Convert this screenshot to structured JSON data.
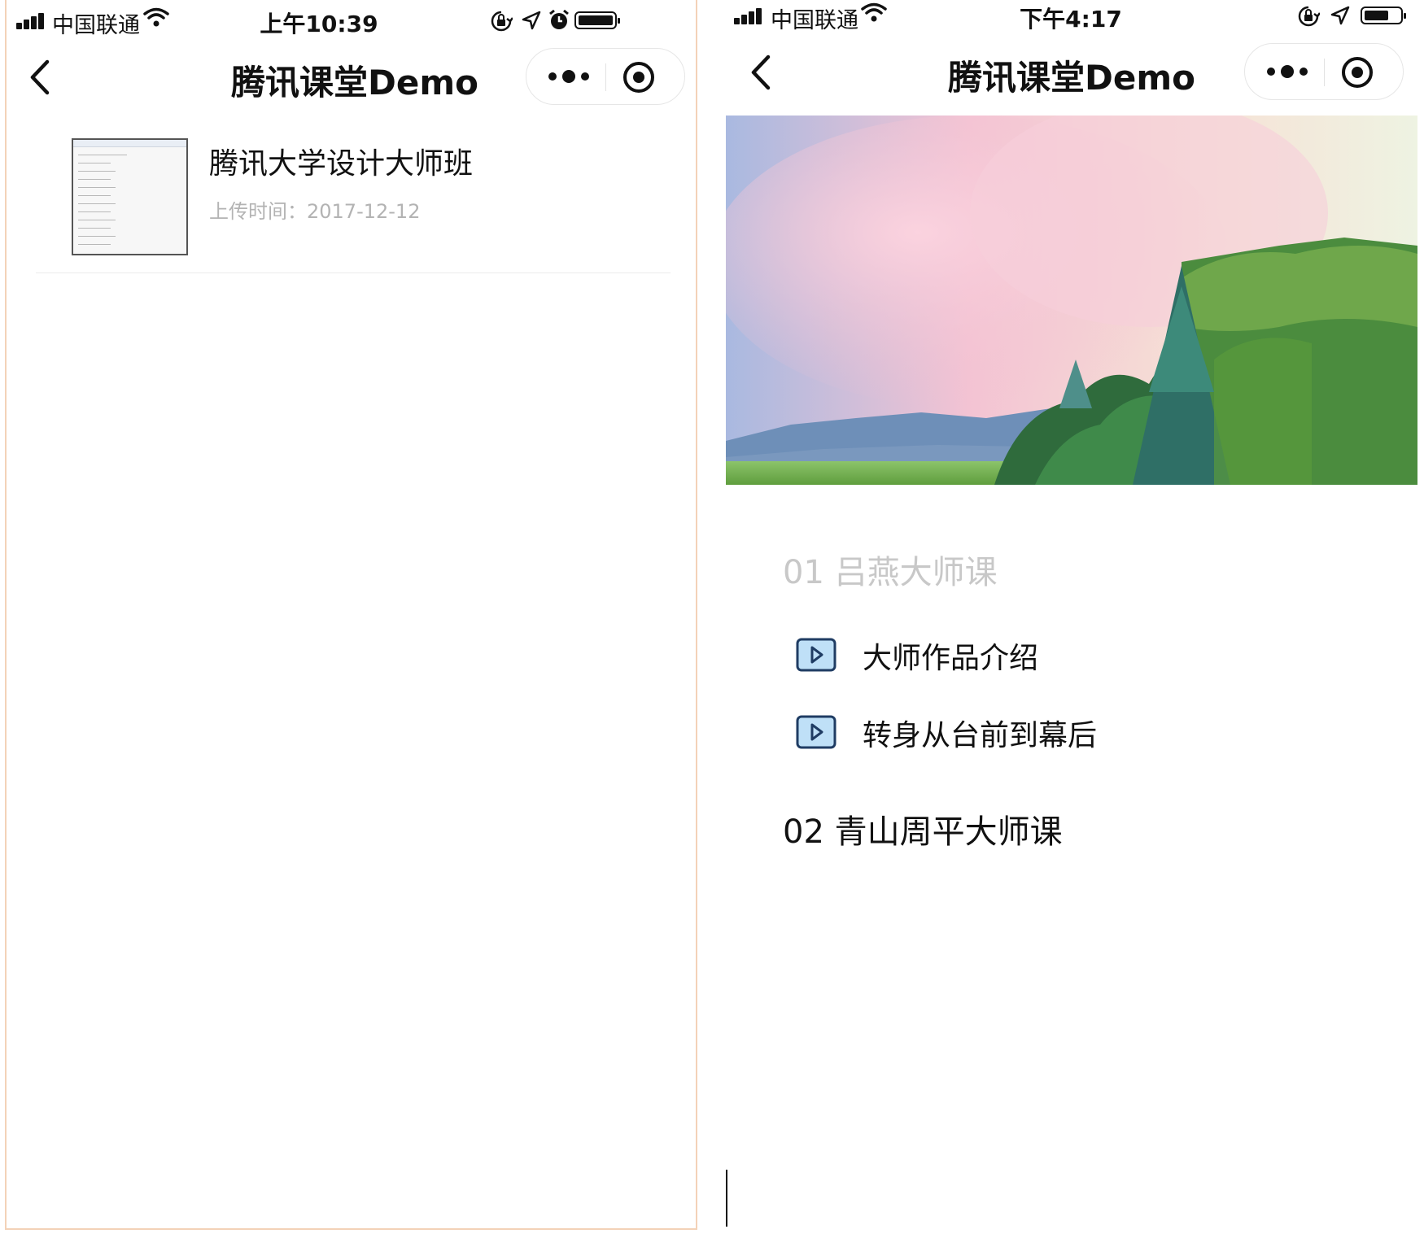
{
  "left_screen": {
    "status_bar": {
      "carrier": "中国联通",
      "time": "上午10:39",
      "battery_percent": 100
    },
    "nav": {
      "title": "腾讯课堂Demo"
    },
    "course_list": [
      {
        "title": "腾讯大学设计大师班",
        "upload_time": "上传时间：2017-12-12"
      }
    ]
  },
  "right_screen": {
    "status_bar": {
      "carrier": "中国联通",
      "time": "下午4:17",
      "battery_percent": 70
    },
    "nav": {
      "title": "腾讯课堂Demo"
    },
    "chapters": [
      {
        "title": "01  吕燕大师课",
        "state": "inactive",
        "lessons": [
          {
            "title": "大师作品介绍"
          },
          {
            "title": "转身从台前到幕后"
          }
        ]
      },
      {
        "title": "02  青山周平大师课",
        "state": "active",
        "lessons": []
      }
    ]
  },
  "icons": [
    "signal-icon",
    "wifi-icon",
    "orientation-lock-icon",
    "location-arrow-icon",
    "alarm-icon",
    "battery-icon",
    "back-chevron-icon",
    "more-dots-icon",
    "close-target-icon",
    "play-icon"
  ],
  "colors": {
    "play_icon_fill": "#bfe0f7",
    "play_icon_stroke": "#1f3c63",
    "muted_text": "#b3b3b3",
    "inactive_chapter": "#c8c8c8",
    "border_accent": "#f3d2b8"
  }
}
